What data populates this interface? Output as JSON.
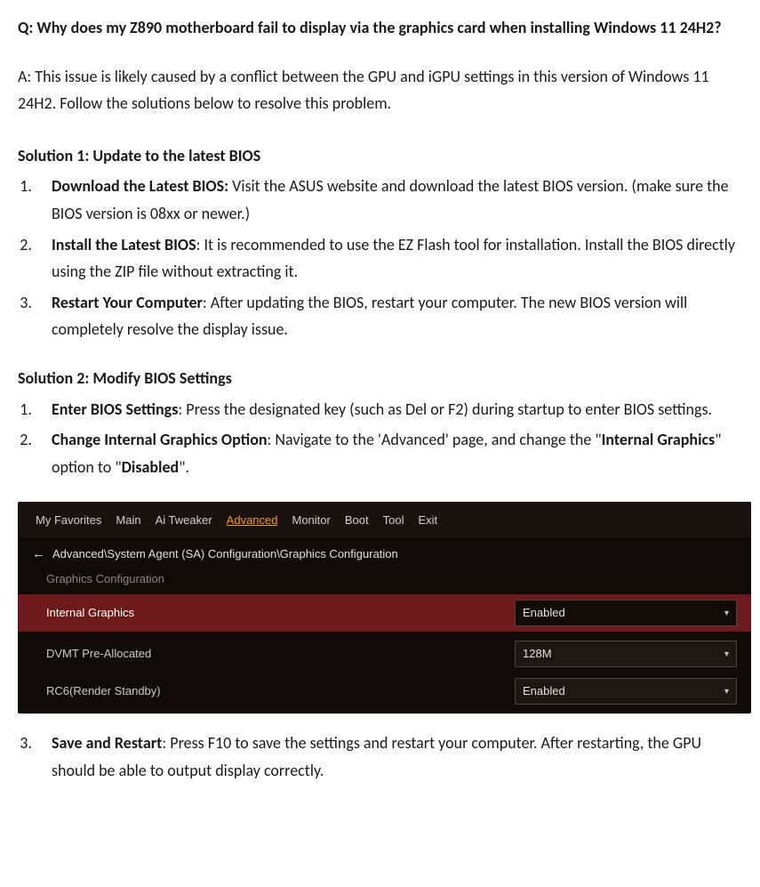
{
  "question": "Q: Why does my Z890 motherboard fail to display via the graphics card when installing Windows 11 24H2?",
  "answer": "A: This issue is likely caused by a conflict between the GPU and iGPU settings in this version of Windows 11 24H2. Follow the solutions below to resolve this problem.",
  "solution1": {
    "heading": "Solution 1: Update to the latest BIOS",
    "steps": [
      {
        "title": "Download the Latest BIOS:",
        "body": " Visit the ASUS website and download the latest BIOS version. (make sure the BIOS version is 08xx or newer.)"
      },
      {
        "title": "Install the Latest BIOS",
        "body": ": It is recommended to use the EZ Flash tool for installation. Install the BIOS directly using the ZIP file without extracting it."
      },
      {
        "title": "Restart Your Computer",
        "body": ": After updating the BIOS, restart your computer. The new BIOS version will completely resolve the display issue."
      }
    ]
  },
  "solution2": {
    "heading": "Solution 2: Modify BIOS Settings",
    "steps_a": [
      {
        "title": "Enter BIOS Settings",
        "body": ": Press the designated key (such as Del or F2) during startup to enter BIOS settings."
      }
    ],
    "step2": {
      "title": "Change Internal Graphics Option",
      "pre": ": Navigate to the 'Advanced' page, and change the \"",
      "bold1": "Internal Graphics",
      "mid": "\" option to \"",
      "bold2": "Disabled",
      "post": "\"."
    },
    "steps_b": [
      {
        "title": "Save and Restart",
        "body": ": Press F10 to save the settings and restart your computer. After restarting, the GPU should be able to output display correctly."
      }
    ]
  },
  "bios": {
    "menu": [
      "My Favorites",
      "Main",
      "Ai Tweaker",
      "Advanced",
      "Monitor",
      "Boot",
      "Tool",
      "Exit"
    ],
    "breadcrumb": "Advanced\\System Agent (SA) Configuration\\Graphics Configuration",
    "subhead": "Graphics Configuration",
    "rows": [
      {
        "label": "Internal Graphics",
        "value": "Enabled",
        "highlight": true
      },
      {
        "label": "DVMT Pre-Allocated",
        "value": "128M",
        "highlight": false
      },
      {
        "label": "RC6(Render Standby)",
        "value": "Enabled",
        "highlight": false
      }
    ]
  }
}
